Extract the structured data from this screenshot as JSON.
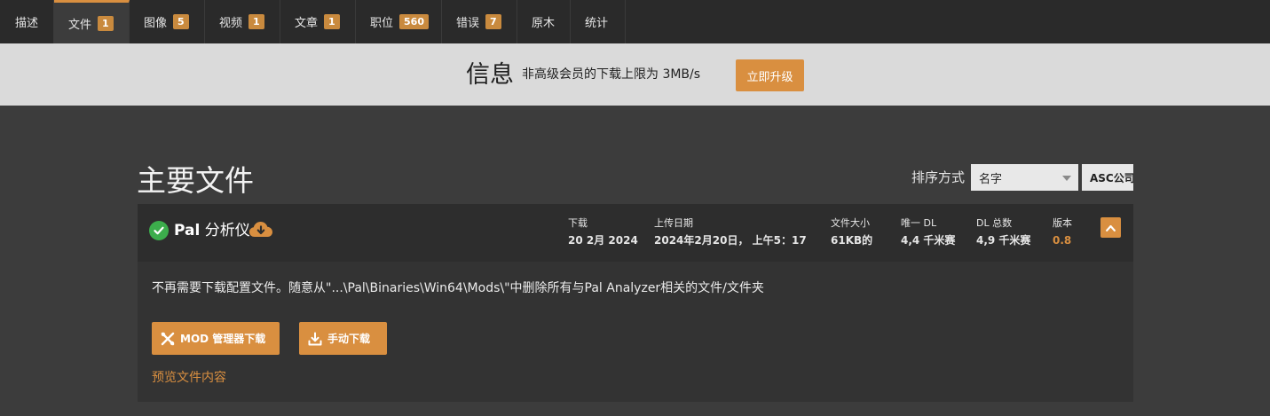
{
  "tabs": [
    {
      "label": "描述",
      "count": null
    },
    {
      "label": "文件",
      "count": "1"
    },
    {
      "label": "图像",
      "count": "5"
    },
    {
      "label": "视频",
      "count": "1"
    },
    {
      "label": "文章",
      "count": "1"
    },
    {
      "label": "职位",
      "count": "560"
    },
    {
      "label": "错误",
      "count": "7"
    },
    {
      "label": "原木",
      "count": null
    },
    {
      "label": "统计",
      "count": null
    }
  ],
  "banner": {
    "title": "信息",
    "text": "非高级会员的下载上限为 3MB/s",
    "button_label": "立即升级"
  },
  "section": {
    "title": "主要文件",
    "sort_label": "排序方式",
    "sort_value": "名字",
    "order_label": "ASC公司"
  },
  "file": {
    "name_bold": "Pal",
    "name_rest": " 分析仪",
    "stats": [
      {
        "label": "下载",
        "value": "20 2月 2024"
      },
      {
        "label": "上传日期",
        "value": "2024年2月20日， 上午5：17"
      },
      {
        "label": "文件大小",
        "value": "61KB的"
      },
      {
        "label": "唯一 DL",
        "value": "4,4 千米赛"
      },
      {
        "label": "DL 总数",
        "value": "4,9 千米赛"
      },
      {
        "label": "版本",
        "value": "0.8"
      }
    ],
    "description": "不再需要下载配置文件。随意从\"...\\Pal\\Binaries\\Win64\\Mods\\\"中删除所有与Pal Analyzer相关的文件/文件夹",
    "mod_manager_button": "MOD 管理器下载",
    "manual_button": "手动下载",
    "preview_link": "预览文件内容"
  },
  "colors": {
    "accent": "#d98f40",
    "success": "#3cad4c",
    "background": "#3c3c3c",
    "tabbar": "#2a2a2a",
    "banner": "#dadada"
  }
}
